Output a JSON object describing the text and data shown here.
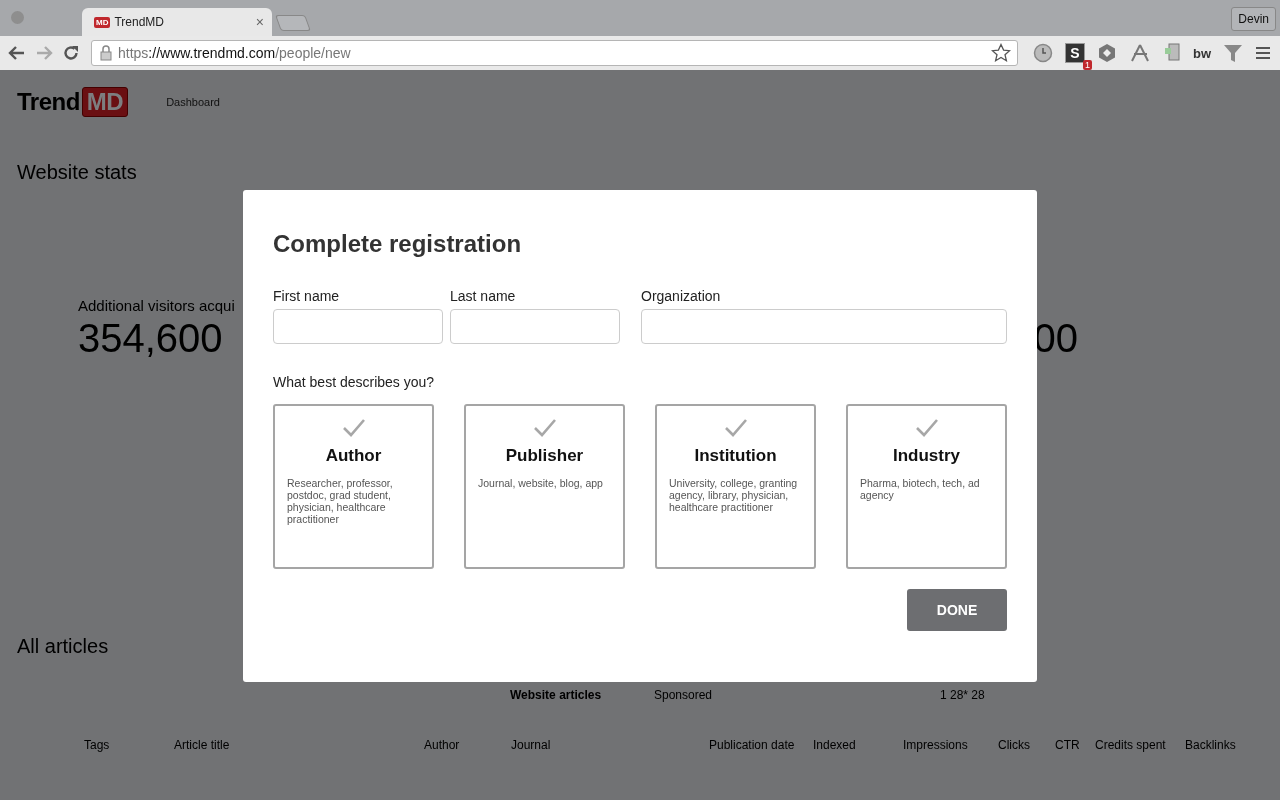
{
  "browser": {
    "tab": {
      "favicon": "MD",
      "title": "TrendMD",
      "close": "×"
    },
    "profile": "Devin",
    "url": {
      "scheme": "https",
      "rest": "://www.trendmd.com",
      "path": "/people/new"
    },
    "extension_letter": "S",
    "extension_badge": "1",
    "extension_text": "bw"
  },
  "header": {
    "logo": {
      "word": "Trend",
      "mark": "MD"
    },
    "nav": [
      "Dashboard"
    ]
  },
  "stats": {
    "title": "Website stats",
    "metric_label": "Additional visitors acqui",
    "metric_value": "354,600",
    "right_value": "00"
  },
  "articles": {
    "title": "All articles",
    "tabs": [
      "Website articles",
      "Sponsored",
      "1 28* 28"
    ],
    "columns": [
      "Tags",
      "Article title",
      "Author",
      "Journal",
      "Publication date",
      "Indexed",
      "Impressions",
      "Clicks",
      "CTR",
      "Credits spent",
      "Backlinks"
    ]
  },
  "modal": {
    "title": "Complete registration",
    "fields": [
      {
        "label": "First name",
        "kind": "half"
      },
      {
        "label": "Last name",
        "kind": "half"
      },
      {
        "label": "Organization",
        "kind": "wide"
      }
    ],
    "question": "What best describes you?",
    "options": [
      {
        "title": "Author",
        "description": "Researcher, professor, postdoc, grad student, physician, healthcare practitioner",
        "selected": false
      },
      {
        "title": "Publisher",
        "description": "Journal, website, blog, app",
        "selected": false
      },
      {
        "title": "Institution",
        "description": "University, college, granting agency, library, physician, healthcare practitioner",
        "selected": false
      },
      {
        "title": "Industry",
        "description": "Pharma, biotech, tech, ad agency",
        "selected": false
      }
    ],
    "button": "DONE"
  }
}
